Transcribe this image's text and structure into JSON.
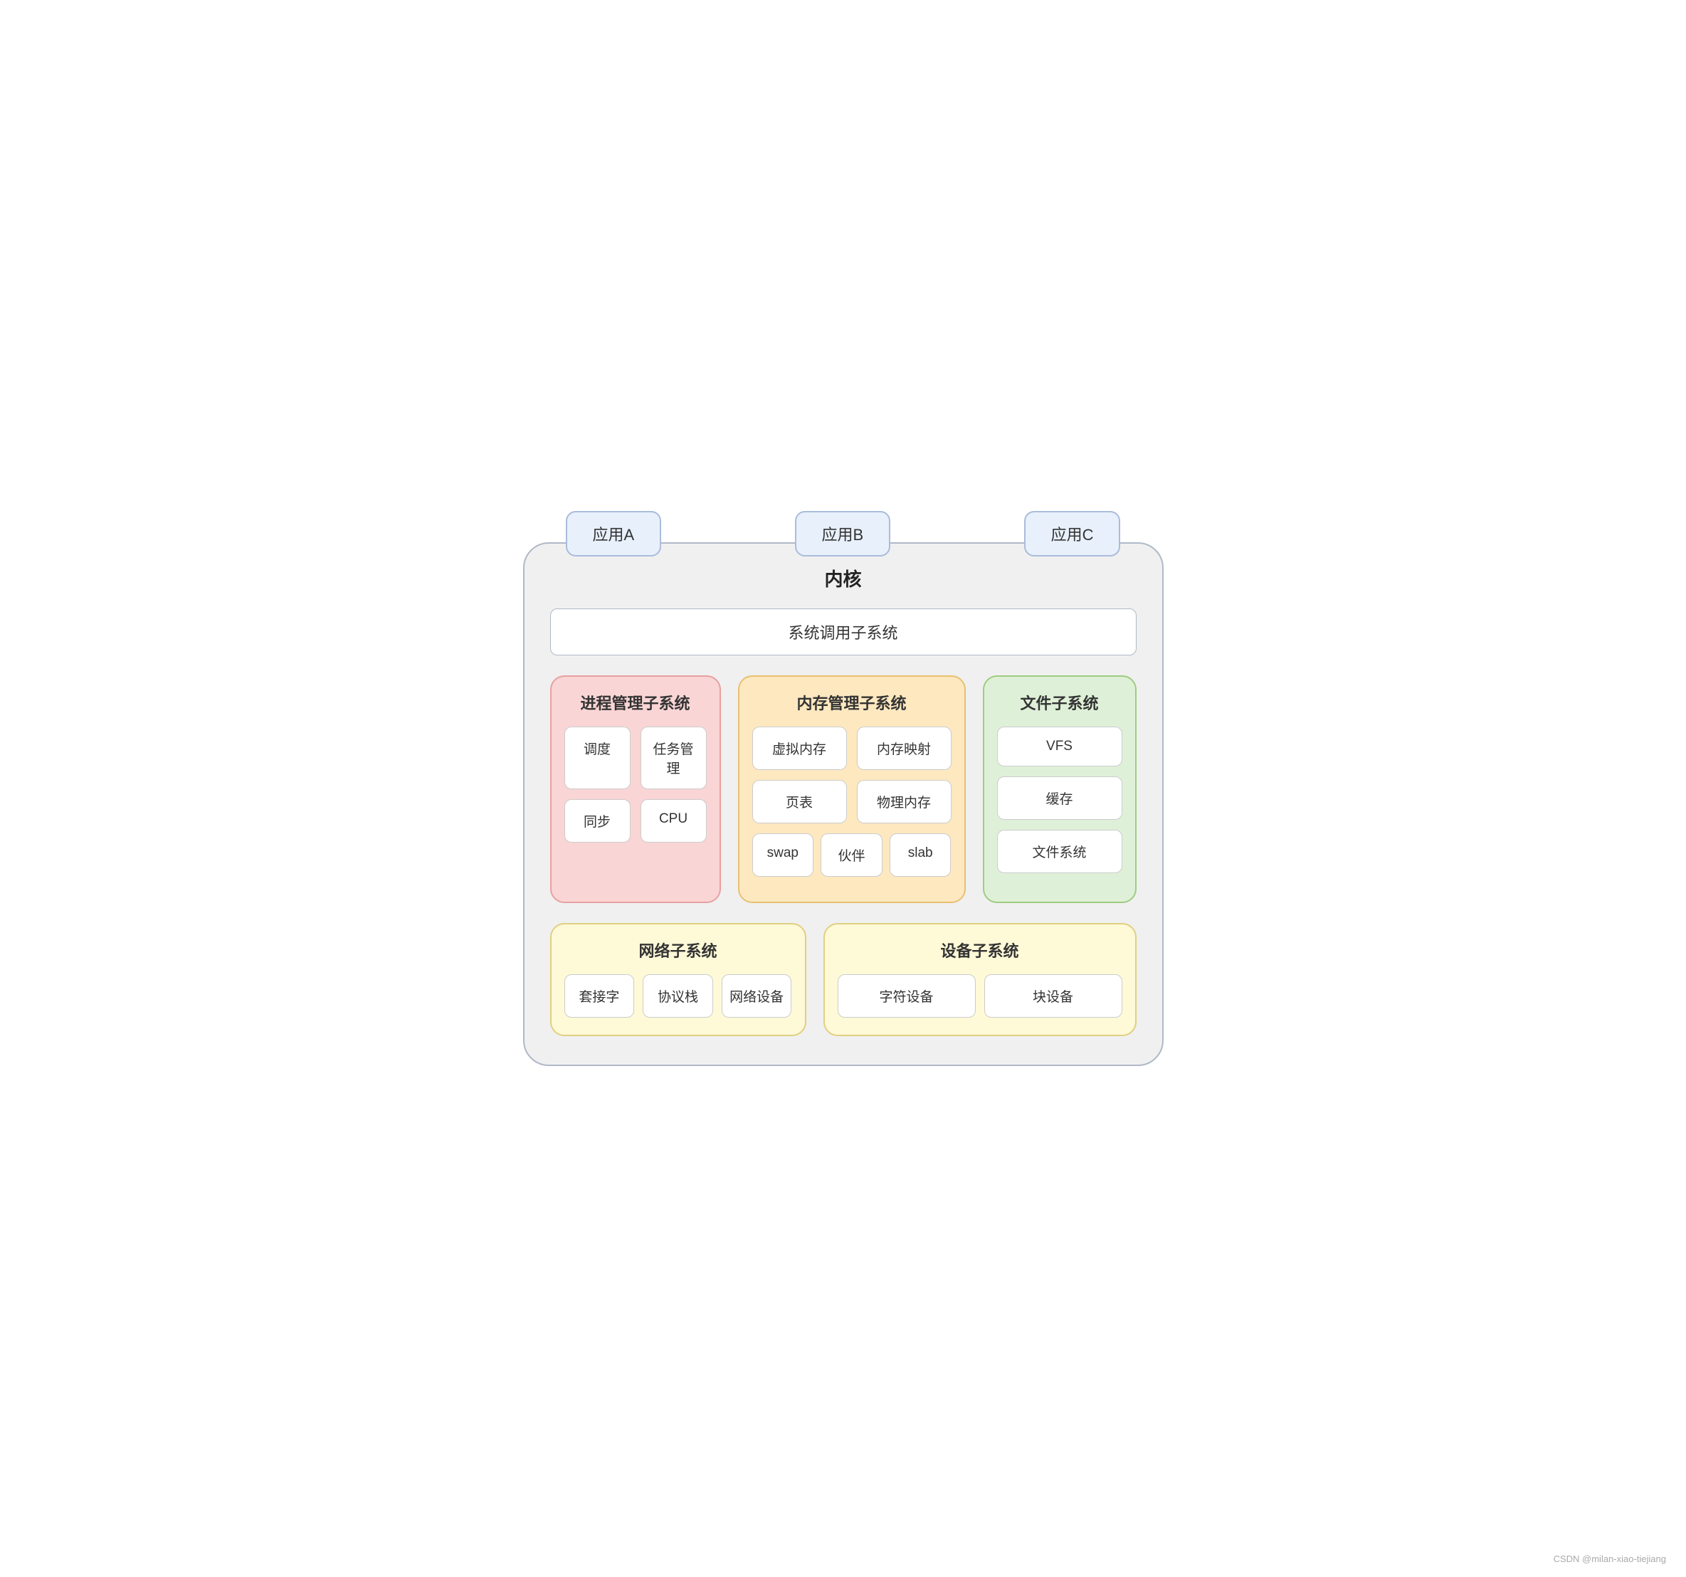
{
  "apps": {
    "appA": "应用A",
    "appB": "应用B",
    "appC": "应用C"
  },
  "kernel": {
    "title": "内核",
    "syscall": "系统调用子系统",
    "process": {
      "title": "进程管理子系统",
      "items": [
        "调度",
        "任务管理",
        "同步",
        "CPU"
      ]
    },
    "memory": {
      "title": "内存管理子系统",
      "row1": [
        "虚拟内存",
        "内存映射"
      ],
      "row2": [
        "页表",
        "物理内存"
      ],
      "row3": [
        "swap",
        "伙伴",
        "slab"
      ]
    },
    "filesystem": {
      "title": "文件子系统",
      "items": [
        "VFS",
        "缓存",
        "文件系统"
      ]
    },
    "network": {
      "title": "网络子系统",
      "items": [
        "套接字",
        "协议栈",
        "网络设备"
      ]
    },
    "device": {
      "title": "设备子系统",
      "items": [
        "字符设备",
        "块设备"
      ]
    }
  },
  "watermark": "CSDN @milan-xiao-tiejiang"
}
